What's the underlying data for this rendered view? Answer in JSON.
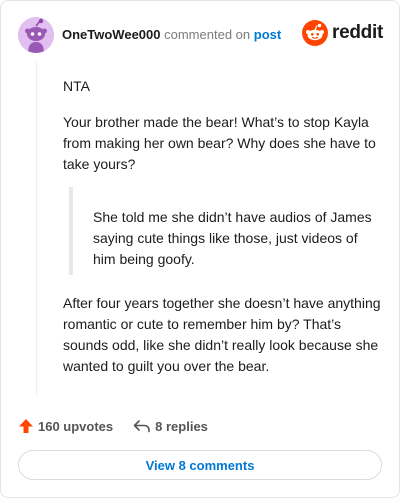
{
  "header": {
    "username": "OneTwoWee000",
    "verb": "commented on",
    "post_link": "post",
    "logo_text": "reddit"
  },
  "comment": {
    "p1": "NTA",
    "p2": "Your brother made the bear! What’s to stop Kayla from making her own bear? Why does she have to take yours?",
    "quote": "She told me she didn’t have audios of James saying cute things like those, just videos of him being goofy.",
    "p3": "After four years together she doesn’t have anything romantic or cute to remember him by? That’s sounds odd, like she didn’t really look because she wanted to guilt you over the bear."
  },
  "actions": {
    "upvotes": "160 upvotes",
    "replies": "8 replies"
  },
  "footer": {
    "view_comments": "View 8 comments"
  },
  "colors": {
    "accent": "#0079d3",
    "upvote": "#ff4500",
    "avatar_bg": "#e1bff0",
    "snoo": "#9b59b6"
  },
  "icons": [
    "snoo-avatar-icon",
    "reddit-logo-icon",
    "upvote-arrow-icon",
    "reply-arrow-icon"
  ]
}
